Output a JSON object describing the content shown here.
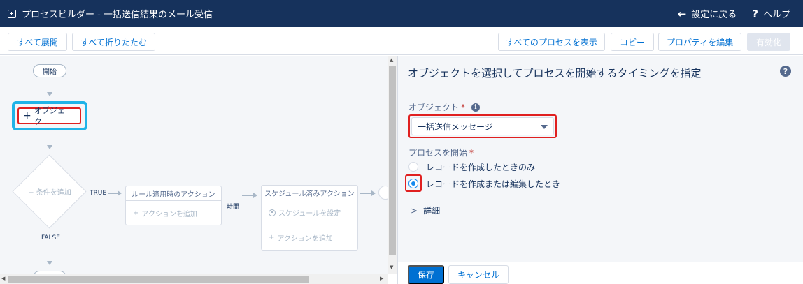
{
  "header": {
    "title": "プロセスビルダー - 一括送信結果のメール受信",
    "back_label": "設定に戻る",
    "help_label": "ヘルプ"
  },
  "toolbar": {
    "expand_all": "すべて展開",
    "collapse_all": "すべて折りたたむ",
    "view_all": "すべてのプロセスを表示",
    "copy": "コピー",
    "edit_props": "プロパティを編集",
    "activate": "有効化"
  },
  "canvas": {
    "start_label": "開始",
    "object_node": "オブジェク...",
    "add_criteria": "条件を追加",
    "true_label": "TRUE",
    "false_label": "FALSE",
    "time_label": "時間",
    "immediate_card": {
      "title": "ルール適用時のアクション",
      "add_action": "アクションを追加"
    },
    "scheduled_card": {
      "title": "スケジュール済みアクション",
      "set_schedule": "スケジュールを設定",
      "add_action": "アクションを追加"
    }
  },
  "panel": {
    "title": "オブジェクトを選択してプロセスを開始するタイミングを指定",
    "object_label": "オブジェクト",
    "object_value": "一括送信メッセージ",
    "start_label": "プロセスを開始",
    "option_create": "レコードを作成したときのみ",
    "option_create_edit": "レコードを作成または編集したとき",
    "selected_option": "option_create_edit",
    "details_label": "詳細",
    "save": "保存",
    "cancel": "キャンセル"
  },
  "colors": {
    "header_bg": "#16325c",
    "brand": "#0070d2",
    "highlight_red": "#e02020",
    "highlight_blue": "#1fb3e8"
  }
}
